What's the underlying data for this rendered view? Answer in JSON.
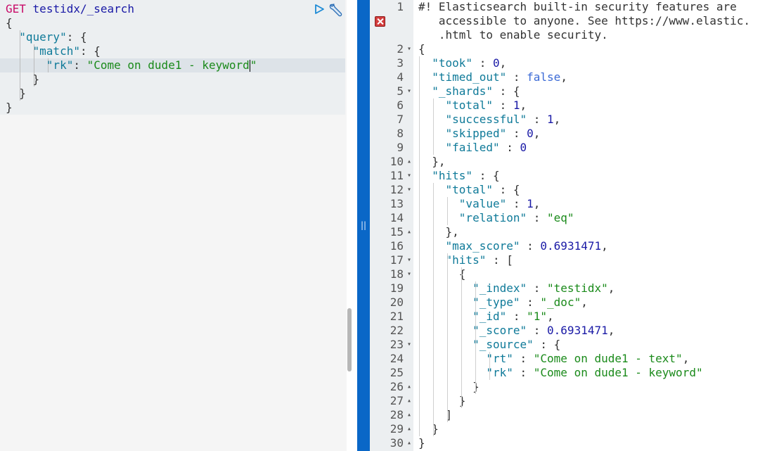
{
  "request": {
    "method": "GET",
    "url": "testidx/_search",
    "lines": [
      [
        "{"
      ],
      [
        "  ",
        {
          "c": "key",
          "t": "\"query\""
        },
        ": {"
      ],
      [
        "    ",
        {
          "c": "key",
          "t": "\"match\""
        },
        ": {"
      ],
      [
        "      ",
        {
          "c": "key",
          "t": "\"rk\""
        },
        ": ",
        {
          "c": "str",
          "t": "\"Come on dude1 - keyword"
        },
        {
          "c": "cursor",
          "t": ""
        },
        {
          "c": "str",
          "t": "\""
        }
      ],
      [
        "    }"
      ],
      [
        "  }"
      ],
      [
        "}"
      ]
    ]
  },
  "response": {
    "warning_lines": [
      "#! Elasticsearch built-in security features are",
      "   accessible to anyone. See https://www.elastic.",
      "   .html to enable security."
    ],
    "line_numbers": [
      "1",
      "2",
      "3",
      "4",
      "5",
      "6",
      "7",
      "8",
      "9",
      "10",
      "11",
      "12",
      "13",
      "14",
      "15",
      "16",
      "17",
      "18",
      "19",
      "20",
      "21",
      "22",
      "23",
      "24",
      "25",
      "26",
      "27",
      "28",
      "29",
      "30"
    ],
    "fold_markers": {
      "2": "▾",
      "5": "▾",
      "10": "▴",
      "11": "▾",
      "12": "▾",
      "15": "▴",
      "17": "▾",
      "18": "▾",
      "23": "▾",
      "26": "▴",
      "27": "▴",
      "28": "▴",
      "29": "▴",
      "30": "▴"
    },
    "lines": [
      [
        "{"
      ],
      [
        "  ",
        {
          "c": "key",
          "t": "\"took\""
        },
        " : ",
        {
          "c": "num",
          "t": "0"
        },
        ","
      ],
      [
        "  ",
        {
          "c": "key",
          "t": "\"timed_out\""
        },
        " : ",
        {
          "c": "bool",
          "t": "false"
        },
        ","
      ],
      [
        "  ",
        {
          "c": "key",
          "t": "\"_shards\""
        },
        " : {"
      ],
      [
        "    ",
        {
          "c": "key",
          "t": "\"total\""
        },
        " : ",
        {
          "c": "num",
          "t": "1"
        },
        ","
      ],
      [
        "    ",
        {
          "c": "key",
          "t": "\"successful\""
        },
        " : ",
        {
          "c": "num",
          "t": "1"
        },
        ","
      ],
      [
        "    ",
        {
          "c": "key",
          "t": "\"skipped\""
        },
        " : ",
        {
          "c": "num",
          "t": "0"
        },
        ","
      ],
      [
        "    ",
        {
          "c": "key",
          "t": "\"failed\""
        },
        " : ",
        {
          "c": "num",
          "t": "0"
        }
      ],
      [
        "  },"
      ],
      [
        "  ",
        {
          "c": "key",
          "t": "\"hits\""
        },
        " : {"
      ],
      [
        "    ",
        {
          "c": "key",
          "t": "\"total\""
        },
        " : {"
      ],
      [
        "      ",
        {
          "c": "key",
          "t": "\"value\""
        },
        " : ",
        {
          "c": "num",
          "t": "1"
        },
        ","
      ],
      [
        "      ",
        {
          "c": "key",
          "t": "\"relation\""
        },
        " : ",
        {
          "c": "str",
          "t": "\"eq\""
        }
      ],
      [
        "    },"
      ],
      [
        "    ",
        {
          "c": "key",
          "t": "\"max_score\""
        },
        " : ",
        {
          "c": "num",
          "t": "0.6931471"
        },
        ","
      ],
      [
        "    ",
        {
          "c": "key",
          "t": "\"hits\""
        },
        " : ["
      ],
      [
        "      {"
      ],
      [
        "        ",
        {
          "c": "key",
          "t": "\"_index\""
        },
        " : ",
        {
          "c": "str",
          "t": "\"testidx\""
        },
        ","
      ],
      [
        "        ",
        {
          "c": "key",
          "t": "\"_type\""
        },
        " : ",
        {
          "c": "str",
          "t": "\"_doc\""
        },
        ","
      ],
      [
        "        ",
        {
          "c": "key",
          "t": "\"_id\""
        },
        " : ",
        {
          "c": "str",
          "t": "\"1\""
        },
        ","
      ],
      [
        "        ",
        {
          "c": "key",
          "t": "\"_score\""
        },
        " : ",
        {
          "c": "num",
          "t": "0.6931471"
        },
        ","
      ],
      [
        "        ",
        {
          "c": "key",
          "t": "\"_source\""
        },
        " : {"
      ],
      [
        "          ",
        {
          "c": "key",
          "t": "\"rt\""
        },
        " : ",
        {
          "c": "str",
          "t": "\"Come on dude1 - text\""
        },
        ","
      ],
      [
        "          ",
        {
          "c": "key",
          "t": "\"rk\""
        },
        " : ",
        {
          "c": "str",
          "t": "\"Come on dude1 - keyword\""
        }
      ],
      [
        "        }"
      ],
      [
        "      }"
      ],
      [
        "    ]"
      ],
      [
        "  }"
      ],
      [
        "}"
      ]
    ]
  },
  "icons": {
    "play": "play-icon",
    "wrench": "wrench-icon",
    "error": "error-icon"
  },
  "colors": {
    "divider": "#0a67c7",
    "method": "#c80a68",
    "key": "#0f7a99",
    "string": "#1a8a1a",
    "number": "#1a1aa6"
  }
}
